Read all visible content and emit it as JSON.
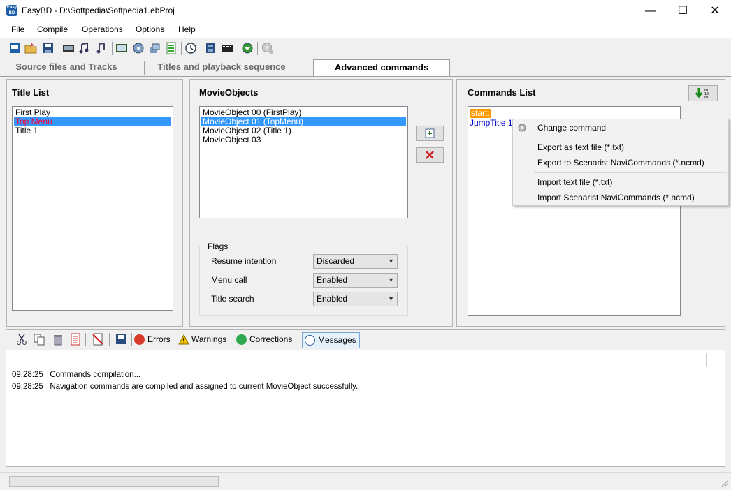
{
  "window": {
    "app_icon_text": "Easy BD",
    "title": "EasyBD - D:\\Softpedia\\Softpedia1.ebProj",
    "minimize": "—",
    "maximize": "☐",
    "close": "✕"
  },
  "menu": [
    "File",
    "Compile",
    "Operations",
    "Options",
    "Help"
  ],
  "tabs": [
    "Source files and Tracks",
    "Titles and playback sequence",
    "Advanced commands"
  ],
  "title_list": {
    "title": "Title List",
    "items": [
      "First Play",
      "Top Menu",
      "Title 1"
    ]
  },
  "movie_objects": {
    "title": "MovieObjects",
    "items": [
      "MovieObject  00  (FirstPlay)",
      "MovieObject  01  (TopMenu)",
      "MovieObject  02  (Title 1)",
      "MovieObject  03"
    ]
  },
  "flags": {
    "label": "Flags",
    "rows": [
      {
        "label": "Resume intention",
        "value": "Discarded"
      },
      {
        "label": "Menu call",
        "value": "Enabled"
      },
      {
        "label": "Title search",
        "value": "Enabled"
      }
    ]
  },
  "commands": {
    "title": "Commands List",
    "items": [
      "start:",
      "JumpTitle 1"
    ]
  },
  "context_menu": {
    "items": [
      "Change command",
      "Export as text file (*.txt)",
      "Export to Scenarist NaviCommands (*.ncmd)",
      "Import text file (*.txt)",
      "Import Scenarist NaviCommands (*.ncmd)"
    ]
  },
  "messages": {
    "tabs": [
      "Errors",
      "Warnings",
      "Corrections",
      "Messages"
    ],
    "log": [
      {
        "time": "09:28:25",
        "text": "Commands compilation..."
      },
      {
        "time": "09:28:25",
        "text": "Navigation commands are compiled and assigned to current MovieObject successfully."
      }
    ]
  },
  "colors": {
    "selection": "#3399ff",
    "top_menu_red": "#ff0033",
    "start_highlight": "#ff9900",
    "command_blue": "#0000cc"
  }
}
